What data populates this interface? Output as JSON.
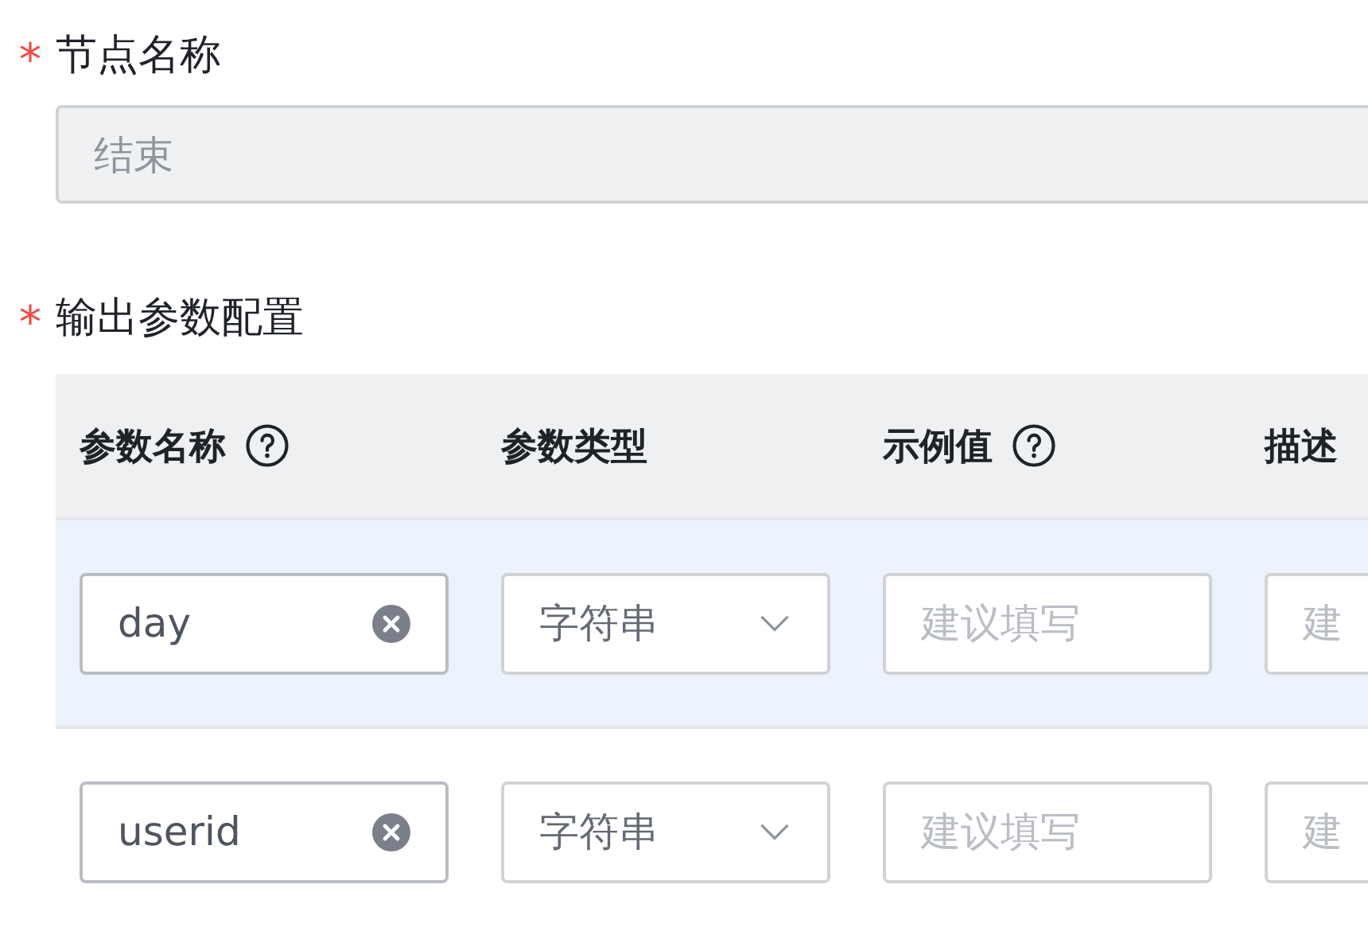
{
  "node_name": {
    "label": "节点名称",
    "required_mark": "*",
    "value": "结束",
    "disabled": true
  },
  "output_params": {
    "label": "输出参数配置",
    "required_mark": "*",
    "columns": [
      {
        "title": "参数名称",
        "help": true
      },
      {
        "title": "参数类型",
        "help": false
      },
      {
        "title": "示例值",
        "help": true
      },
      {
        "title": "描述",
        "help": false
      }
    ],
    "rows": [
      {
        "hovered": true,
        "name": "day",
        "type": "字符串",
        "example_placeholder": "建议填写",
        "description_placeholder": "建"
      },
      {
        "hovered": false,
        "name": "userid",
        "type": "字符串",
        "example_placeholder": "建议填写",
        "description_placeholder": "建"
      }
    ]
  }
}
